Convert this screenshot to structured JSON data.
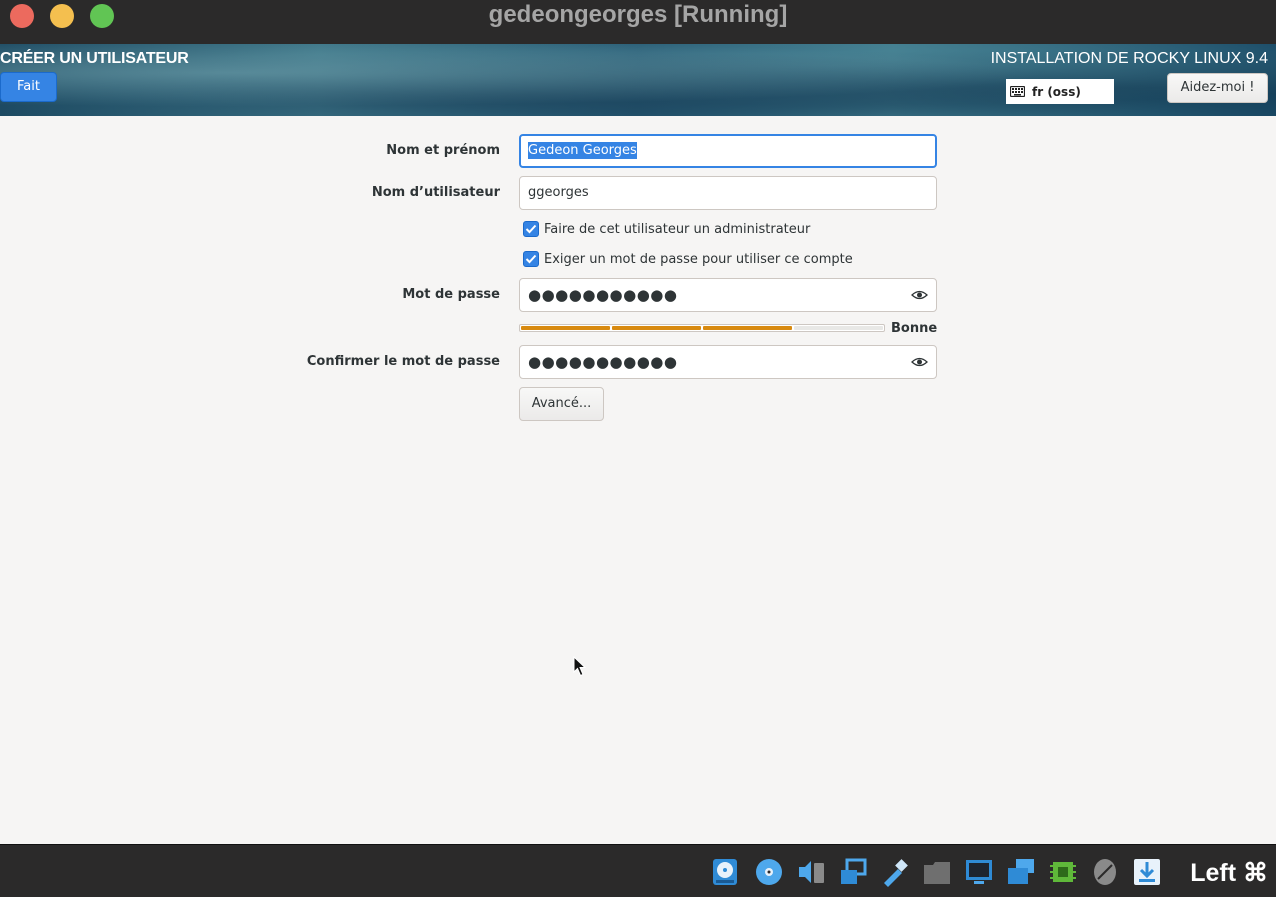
{
  "window": {
    "title": "gedeongeorges [Running]"
  },
  "header": {
    "spoke_title": "CRÉER UN UTILISATEUR",
    "done_label": "Fait",
    "product_title": "INSTALLATION DE ROCKY LINUX 9.4",
    "keyboard_layout": "fr (oss)",
    "help_label": "Aidez-moi !"
  },
  "form": {
    "fullname": {
      "label": "Nom et prénom",
      "value": "Gedeon Georges"
    },
    "username": {
      "label": "Nom d’utilisateur",
      "value": "ggeorges"
    },
    "admin_checkbox": {
      "label": "Faire de cet utilisateur un administrateur",
      "checked": true
    },
    "require_password_checkbox": {
      "label": "Exiger un mot de passe pour utiliser ce compte",
      "checked": true
    },
    "password": {
      "label": "Mot de passe",
      "value": "●●●●●●●●●●●"
    },
    "password_strength": {
      "label": "Bonne",
      "level": 0.75
    },
    "confirm_password": {
      "label": "Confirmer le mot de passe",
      "value": "●●●●●●●●●●●"
    },
    "advanced_label": "Avancé..."
  },
  "statusbar": {
    "host_key": "Left ⌘"
  },
  "colors": {
    "accent": "#3584e4",
    "strength": "#d88a10",
    "background": "#f6f5f4"
  }
}
